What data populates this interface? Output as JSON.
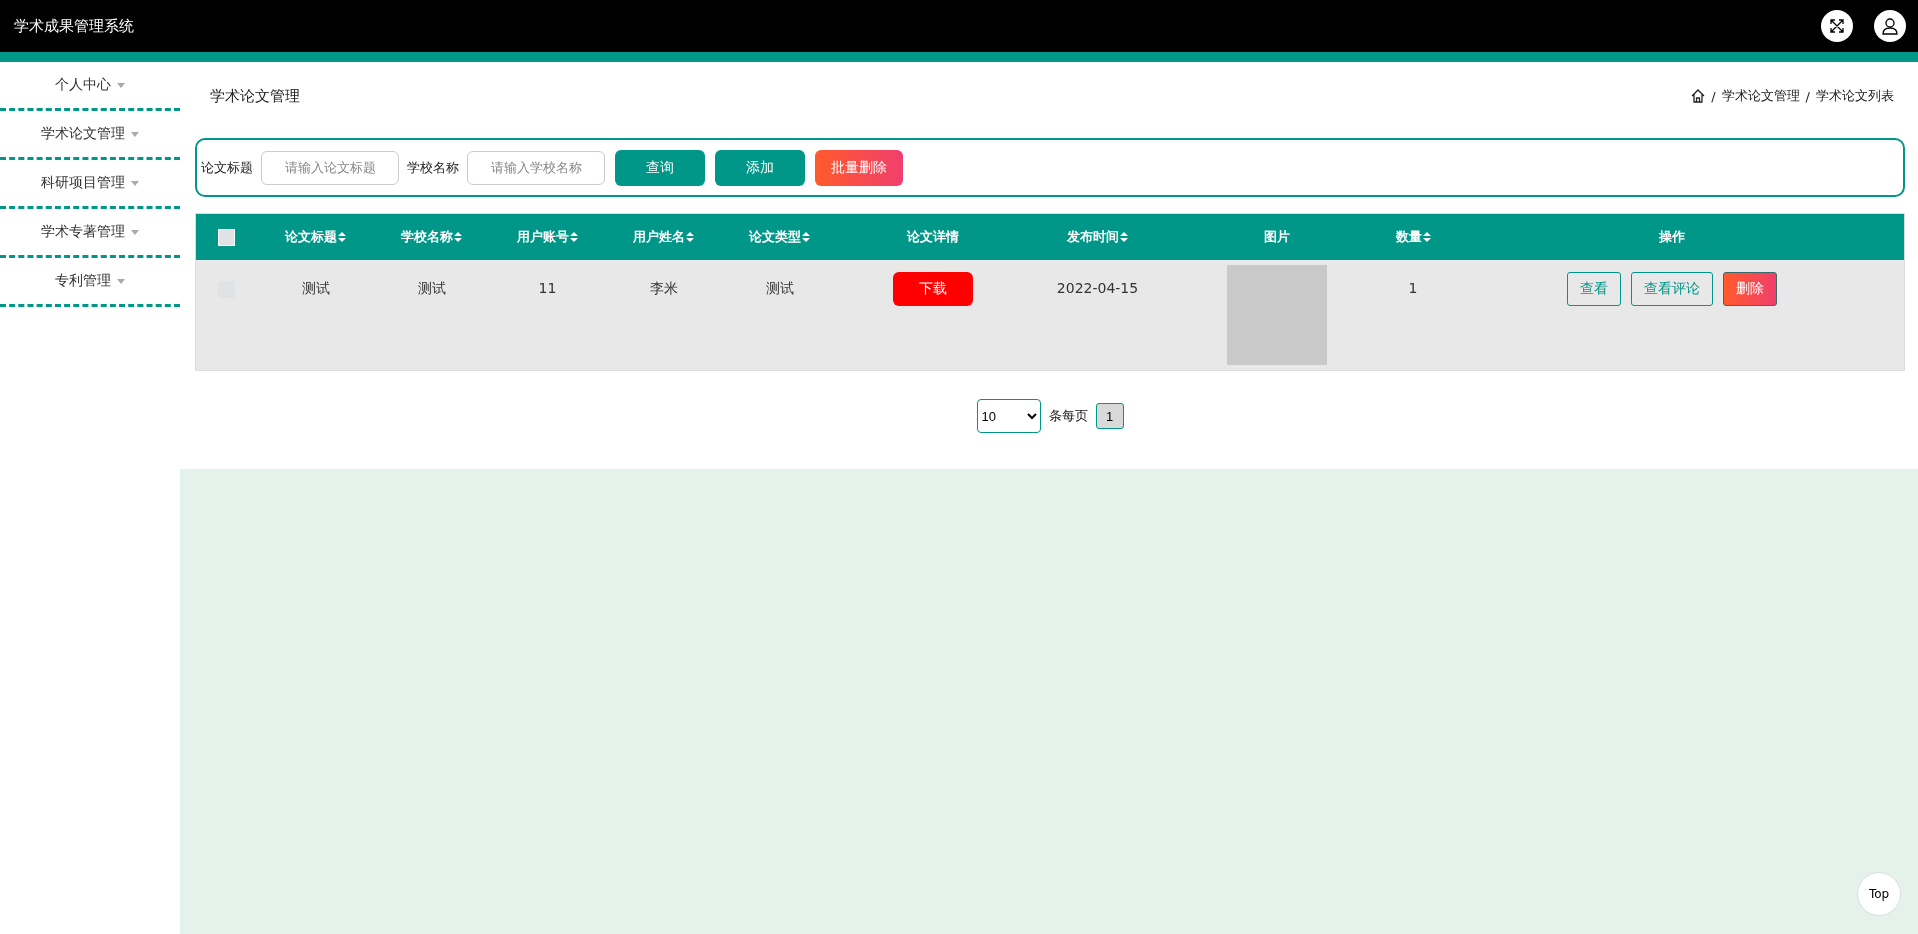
{
  "header": {
    "title": "学术成果管理系统"
  },
  "sidebar": {
    "items": [
      {
        "label": "个人中心"
      },
      {
        "label": "学术论文管理"
      },
      {
        "label": "科研项目管理"
      },
      {
        "label": "学术专著管理"
      },
      {
        "label": "专利管理"
      }
    ]
  },
  "page": {
    "title": "学术论文管理",
    "breadcrumb": [
      {
        "separator": "/",
        "label": "学术论文管理"
      },
      {
        "separator": "/",
        "label": "学术论文列表"
      }
    ]
  },
  "search": {
    "fields": [
      {
        "label": "论文标题",
        "placeholder": "请输入论文标题"
      },
      {
        "label": "学校名称",
        "placeholder": "请输入学校名称"
      }
    ],
    "buttons": [
      {
        "label": "查询",
        "kind": "primary"
      },
      {
        "label": "添加",
        "kind": "primary"
      },
      {
        "label": "批量删除",
        "kind": "danger"
      }
    ]
  },
  "table": {
    "select_all": {
      "checked": false
    },
    "columns": [
      {
        "label": "论文标题",
        "sortable": true
      },
      {
        "label": "学校名称",
        "sortable": true
      },
      {
        "label": "用户账号",
        "sortable": true
      },
      {
        "label": "用户姓名",
        "sortable": true
      },
      {
        "label": "论文类型",
        "sortable": true
      },
      {
        "label": "论文详情",
        "sortable": false
      },
      {
        "label": "发布时间",
        "sortable": true
      },
      {
        "label": "图片",
        "sortable": false
      },
      {
        "label": "数量",
        "sortable": true
      },
      {
        "label": "操作",
        "sortable": false
      }
    ],
    "rows": [
      {
        "selected": false,
        "cells": [
          {
            "kind": "text",
            "text": "测试"
          },
          {
            "kind": "text",
            "text": "测试"
          },
          {
            "kind": "text",
            "text": "11"
          },
          {
            "kind": "text",
            "text": "李米"
          },
          {
            "kind": "text",
            "text": "测试"
          },
          {
            "kind": "button",
            "text": "下载"
          },
          {
            "kind": "text",
            "text": "2022-04-15"
          },
          {
            "kind": "image"
          },
          {
            "kind": "text",
            "text": "1"
          },
          {
            "kind": "actions",
            "buttons": [
              {
                "label": "查看",
                "kind": "outline"
              },
              {
                "label": "查看评论",
                "kind": "outline"
              },
              {
                "label": "删除",
                "kind": "danger"
              }
            ]
          }
        ]
      }
    ]
  },
  "pagination": {
    "page_size": "10",
    "per_page_label": "条每页",
    "pages": [
      {
        "label": "1",
        "selected": true
      }
    ]
  },
  "back_to_top": "Top"
}
